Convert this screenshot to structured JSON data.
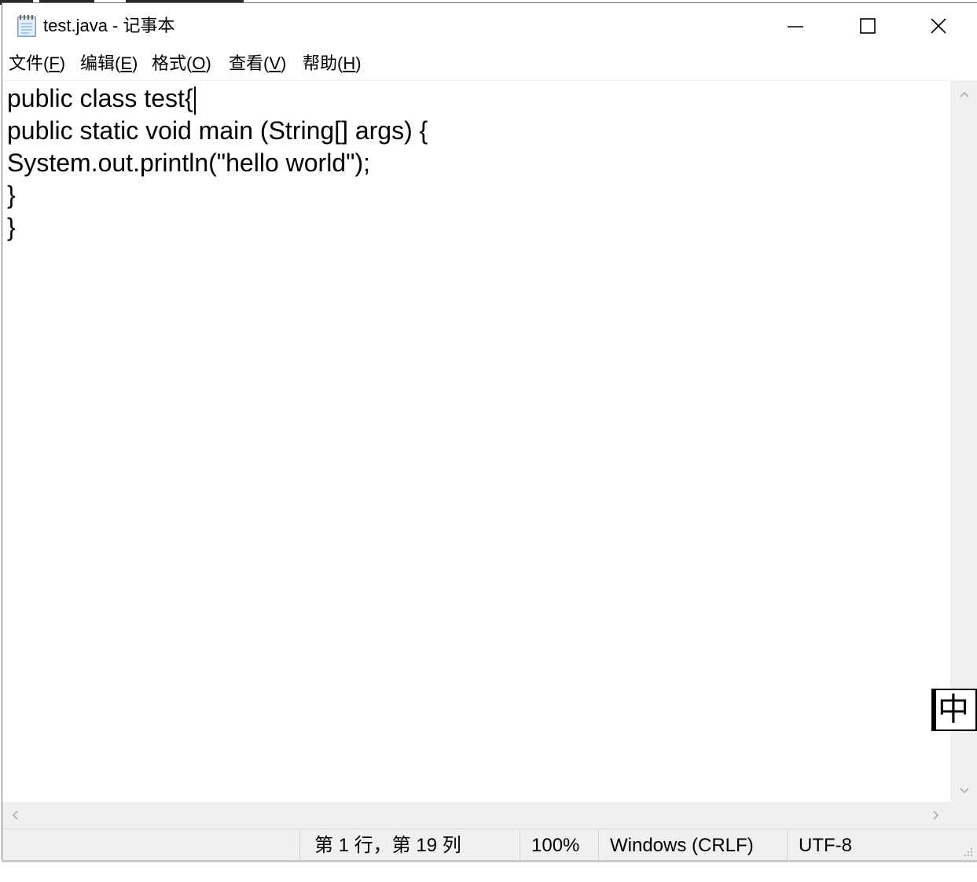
{
  "window": {
    "title": "test.java - 记事本",
    "icon": "notepad-icon"
  },
  "titlebar_buttons": {
    "minimize_icon": "minimize-icon",
    "maximize_icon": "maximize-icon",
    "close_icon": "close-icon"
  },
  "menu": {
    "items": [
      {
        "label": "文件(",
        "mnemonic": "F",
        "suffix": ")"
      },
      {
        "label": "编辑(",
        "mnemonic": "E",
        "suffix": ")"
      },
      {
        "label": "格式(",
        "mnemonic": "O",
        "suffix": ")"
      },
      {
        "label": "查看(",
        "mnemonic": "V",
        "suffix": ")"
      },
      {
        "label": "帮助(",
        "mnemonic": "H",
        "suffix": ")"
      }
    ]
  },
  "editor": {
    "lines": [
      "public class test{",
      "public static void main (String[] args) {",
      "System.out.println(\"hello world\");",
      "}",
      "}"
    ]
  },
  "ime": {
    "mode": "中"
  },
  "status": {
    "position": "第 1 行，第 19 列",
    "zoom": "100%",
    "line_ending": "Windows (CRLF)",
    "encoding": "UTF-8"
  }
}
